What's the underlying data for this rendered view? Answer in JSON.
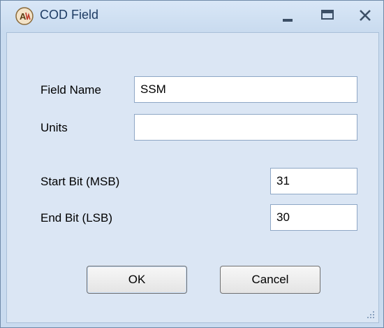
{
  "window": {
    "title": "COD Field",
    "icon": "app-logo-icon",
    "controls": [
      "minimize-icon",
      "maximize-icon",
      "close-icon"
    ]
  },
  "form": {
    "field_name": {
      "label": "Field Name",
      "value": "SSM"
    },
    "units": {
      "label": "Units",
      "value": ""
    },
    "start_bit": {
      "label": "Start Bit (MSB)",
      "value": "31"
    },
    "end_bit": {
      "label": "End Bit (LSB)",
      "value": "30"
    }
  },
  "buttons": {
    "ok_label": "OK",
    "cancel_label": "Cancel"
  },
  "colors": {
    "frame": "#c9dbef",
    "client": "#dbe6f4",
    "title_text": "#1e3c64"
  }
}
